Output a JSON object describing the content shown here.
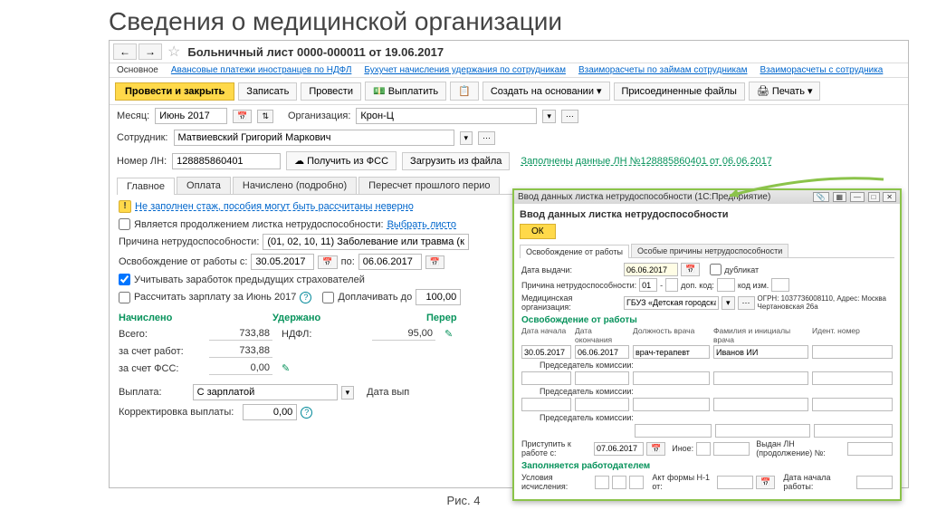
{
  "slide_title": "Сведения о медицинской организации",
  "figure_caption": "Рис. 4",
  "doc_title": "Больничный лист 0000-000011 от 19.06.2017",
  "nav": {
    "back": "←",
    "fwd": "→"
  },
  "link_tabs": {
    "main": "Основное",
    "t1": "Авансовые платежи иностранцев по НДФЛ",
    "t2": "Бухучет начисления удержания по сотрудникам",
    "t3": "Взаиморасчеты по займам сотрудникам",
    "t4": "Взаиморасчеты с сотрудника"
  },
  "actions": {
    "post_close": "Провести и закрыть",
    "save": "Записать",
    "post": "Провести",
    "pay": "Выплатить",
    "create": "Создать на основании",
    "attach": "Присоединенные файлы",
    "print": "Печать"
  },
  "form": {
    "month_lbl": "Месяц:",
    "month": "Июнь 2017",
    "org_lbl": "Организация:",
    "org": "Крон-Ц",
    "emp_lbl": "Сотрудник:",
    "emp": "Матвиевский Григорий Маркович",
    "ln_lbl": "Номер ЛН:",
    "ln": "128885860401",
    "get_fss": "Получить из ФСС",
    "load_file": "Загрузить из файла",
    "filled_link": "Заполнены данные ЛН №128885860401 от 06.06.2017"
  },
  "tabs": {
    "t1": "Главное",
    "t2": "Оплата",
    "t3": "Начислено (подробно)",
    "t4": "Пересчет прошлого перио"
  },
  "main_tab": {
    "warn": "Не заполнен стаж, пособия могут быть рассчитаны неверно",
    "continuation_lbl": "Является продолжением листка нетрудоспособности:",
    "continuation_pick": "Выбрать листо",
    "reason_lbl": "Причина нетрудоспособности:",
    "reason": "(01, 02, 10, 11) Заболевание или травма (к",
    "release_lbl": "Освобождение от работы с:",
    "date_from": "30.05.2017",
    "to": "по:",
    "date_to": "06.06.2017",
    "prev_insurers": "Учитывать заработок предыдущих страхователей",
    "calc_salary": "Рассчитать зарплату за Июнь 2017",
    "topup_lbl": "Доплачивать до",
    "topup_val": "100,00",
    "h_accrued": "Начислено",
    "h_withheld": "Удержано",
    "h_transfer": "Перер",
    "r_total": "Всего:",
    "v_total": "733,88",
    "r_ndfl": "НДФЛ:",
    "v_ndfl": "95,00",
    "r_employer": "за счет работ:",
    "v_employer": "733,88",
    "r_fss": "за счет ФСС:",
    "v_fss": "0,00",
    "payout_lbl": "Выплата:",
    "payout": "С зарплатой",
    "payout_date_lbl": "Дата вып",
    "corr_lbl": "Корректировка выплаты:",
    "corr_val": "0,00"
  },
  "modal": {
    "titlebar": "Ввод данных листка нетрудоспособности (1С:Предприятие)",
    "heading": "Ввод данных листка нетрудоспособности",
    "ok": "ОК",
    "tab1": "Освобождение от работы",
    "tab2": "Особые причины нетрудоспособности",
    "date_issue_lbl": "Дата выдачи:",
    "date_issue": "06.06.2017",
    "dup": "дубликат",
    "reason_lbl": "Причина нетрудоспособности:",
    "reason_code": "01",
    "reason_dash": "-",
    "add_lbl": "доп. код:",
    "code_change_lbl": "код изм.",
    "medorg_lbl": "Медицинская организация:",
    "medorg": "ГБУЗ «Детская городская»",
    "medorg_extra": "ОГРН: 1037736008110, Адрес: Москва Чертановская 26а",
    "sec_release": "Освобождение от работы",
    "col_start": "Дата начала",
    "col_end": "Дата окончания",
    "col_doc": "Должность врача",
    "col_docname": "Фамилия и инициалы врача",
    "col_id": "Идент. номер",
    "d1_start": "30.05.2017",
    "d1_end": "06.06.2017",
    "d1_doc": "врач-терапевт",
    "d1_name": "Иванов ИИ",
    "chair": "Председатель комиссии:",
    "start_work_lbl": "Приступить к работе с:",
    "start_work": "07.06.2017",
    "other": "Иное:",
    "issued_cont": "Выдан ЛН (продолжение) №:",
    "sec_employer": "Заполняется работодателем",
    "calc_cond": "Условия исчисления:",
    "act_lbl": "Акт формы Н-1 от:",
    "work_start_lbl": "Дата начала работы:"
  }
}
